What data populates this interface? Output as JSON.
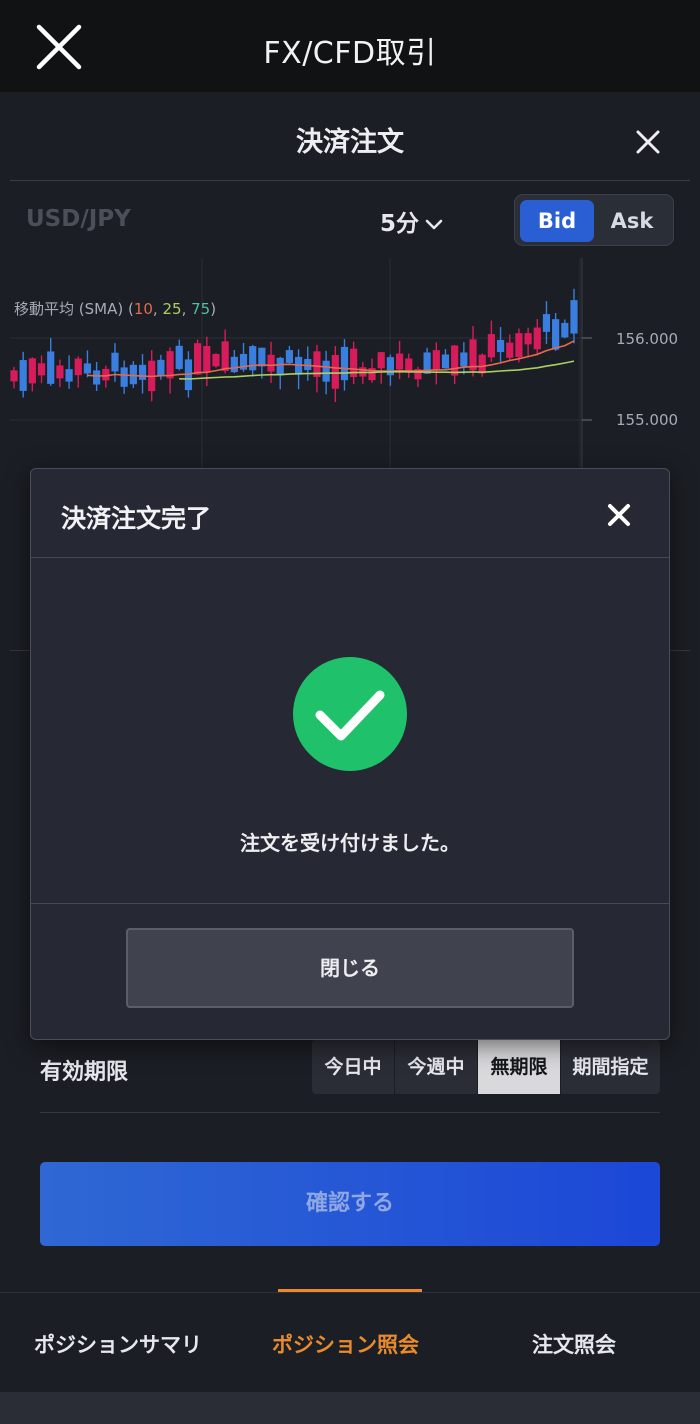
{
  "topbar": {
    "title": "FX/CFD取引",
    "close_icon": "close-x-icon"
  },
  "sheet": {
    "title": "決済注文",
    "close_icon": "close-icon"
  },
  "symbol": {
    "name": "USD/JPY",
    "timeframe": "5分",
    "bid_label": "Bid",
    "ask_label": "Ask",
    "selected": "Bid"
  },
  "chart": {
    "sma_prefix": "移動平均 (SMA) (",
    "sma_periods": [
      "10",
      "25",
      "75"
    ],
    "sma_sep": ", ",
    "sma_suffix": ")",
    "sma_colors": [
      "#e46a4d",
      "#a9d160",
      "#4fc0a0"
    ],
    "price_labels": [
      "156.000",
      "155.000"
    ],
    "up_color": "#d81b5b",
    "down_color": "#3a7ee0"
  },
  "modal": {
    "title": "決済注文完了",
    "message": "注文を受け付けました。",
    "close_button": "閉じる",
    "icon": "check-circle-icon",
    "accent": "#1fc16b"
  },
  "expiry": {
    "label": "有効期限",
    "options": [
      "今日中",
      "今週中",
      "無期限",
      "期間指定"
    ],
    "selected": "無期限"
  },
  "confirm_button": "確認する",
  "tabs": [
    {
      "label": "ポジションサマリ",
      "active": false
    },
    {
      "label": "ポジション照会",
      "active": true
    },
    {
      "label": "注文照会",
      "active": false
    }
  ]
}
